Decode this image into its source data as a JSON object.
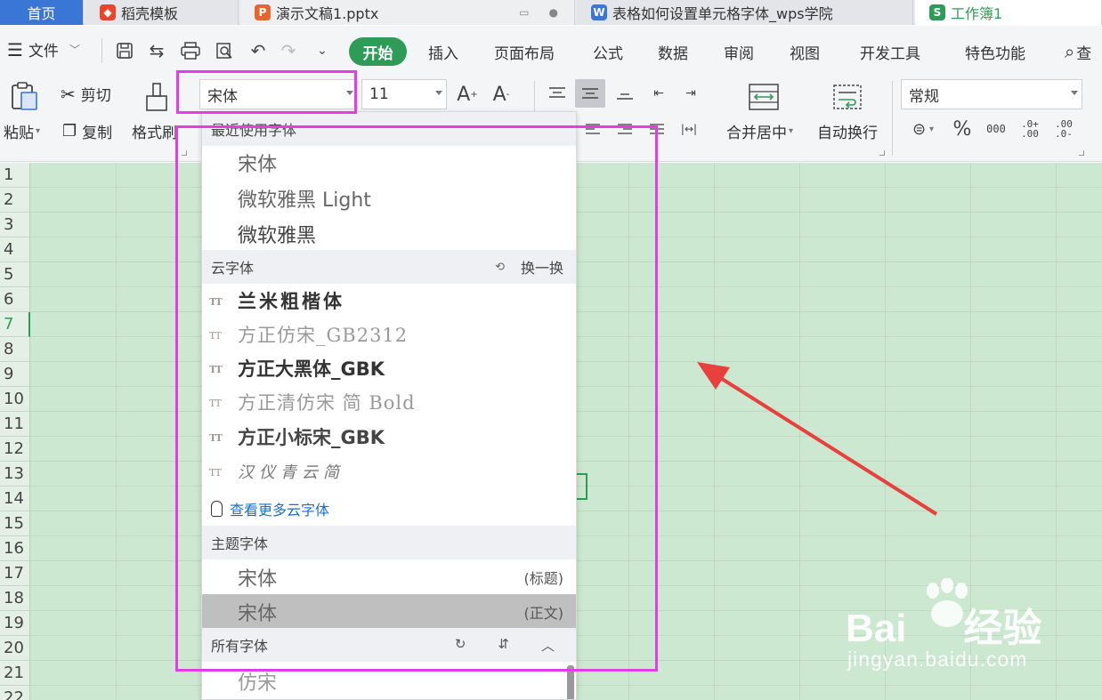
{
  "tabs": {
    "home": "首页",
    "items": [
      {
        "label": "稻壳模板",
        "icon_color": "#e8452c"
      },
      {
        "label": "演示文稿1.pptx",
        "icon_color": "#e8652c"
      },
      {
        "label": "表格如何设置单元格字体_wps学院",
        "icon_color": "#3a76d6"
      },
      {
        "label": "工作簿1",
        "icon_color": "#2e9c57"
      }
    ]
  },
  "menu": {
    "file_label": "文件",
    "start_label": "开始",
    "items": [
      "插入",
      "页面布局",
      "公式",
      "数据",
      "审阅",
      "视图",
      "开发工具",
      "特色功能"
    ],
    "search_label": "查"
  },
  "ribbon": {
    "paste_label": "粘贴",
    "cut_label": "剪切",
    "copy_label": "复制",
    "format_painter_label": "格式刷",
    "font_name": "宋体",
    "font_size": "11",
    "merge_label": "合并居中",
    "wrap_label": "自动换行",
    "number_format": "常规"
  },
  "font_dropdown": {
    "recent_header": "最近使用字体",
    "recent": [
      "宋体",
      "微软雅黑 Light",
      "微软雅黑"
    ],
    "cloud_header": "云字体",
    "swap_label": "换一换",
    "cloud_fonts": [
      "兰米粗楷体",
      "方正仿宋_GB2312",
      "方正大黑体_GBK",
      "方正清仿宋 简 Bold",
      "方正小标宋_GBK",
      "汉仪青云简"
    ],
    "more_cloud_label": "查看更多云字体",
    "theme_header": "主题字体",
    "theme_fonts": [
      {
        "name": "宋体",
        "tag": "(标题)"
      },
      {
        "name": "宋体",
        "tag": "(正文)"
      }
    ],
    "all_header": "所有字体",
    "all_fonts": [
      "仿宋"
    ]
  },
  "rows": [
    "1",
    "2",
    "3",
    "4",
    "5",
    "6",
    "7",
    "8",
    "9",
    "10",
    "11",
    "12",
    "13",
    "14",
    "15",
    "16",
    "17",
    "18",
    "19",
    "20",
    "21",
    "22"
  ],
  "active_row": "7",
  "watermark": {
    "brand": "Bai",
    "brand2": "经验",
    "url": "jingyan.baidu.com"
  },
  "colors": {
    "accent": "#2e9c57",
    "highlight": "#e43ce7",
    "arrow": "#e8403c"
  }
}
